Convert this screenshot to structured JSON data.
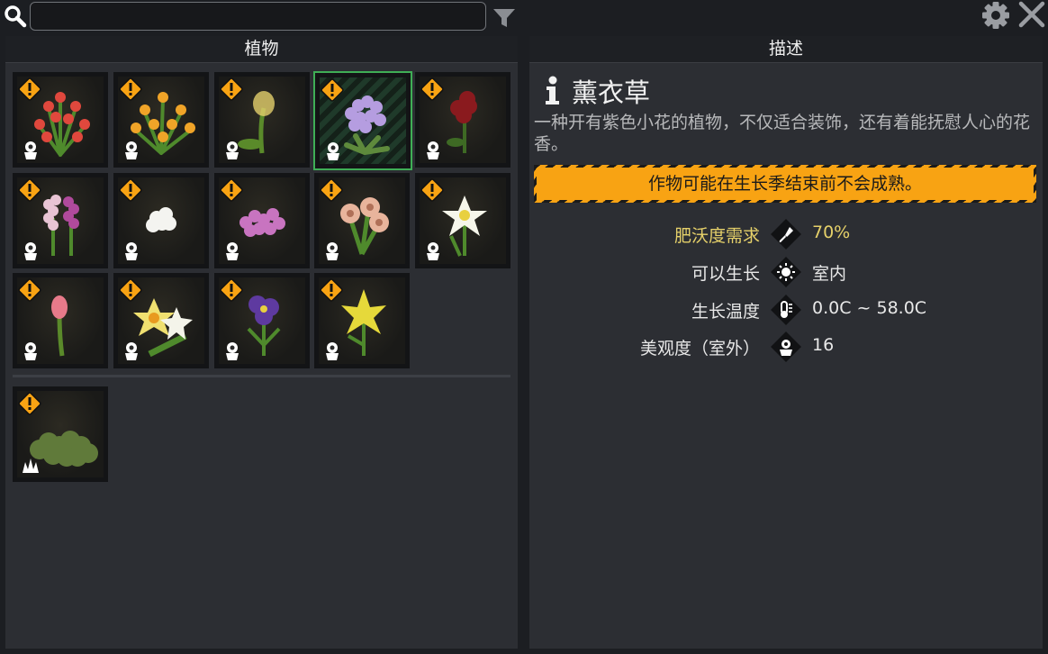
{
  "search": {
    "value": "",
    "placeholder": ""
  },
  "left_panel": {
    "title": "植物"
  },
  "right_panel": {
    "title": "描述"
  },
  "plants": [
    {
      "icon": "red-flower-plant",
      "warning": true,
      "type": "flower-pot"
    },
    {
      "icon": "orange-flower-plant",
      "warning": true,
      "type": "flower-pot"
    },
    {
      "icon": "yellow-tulip-plant",
      "warning": true,
      "type": "flower-pot"
    },
    {
      "icon": "lavender-plant",
      "warning": true,
      "type": "flower-pot",
      "selected": true
    },
    {
      "icon": "dark-red-rose-plant",
      "warning": true,
      "type": "flower-pot"
    },
    {
      "icon": "hyacinth-plant",
      "warning": true,
      "type": "flower-pot"
    },
    {
      "icon": "white-flower-plant",
      "warning": true,
      "type": "flower-pot"
    },
    {
      "icon": "pink-phlox-plant",
      "warning": true,
      "type": "flower-pot"
    },
    {
      "icon": "peach-rose-plant",
      "warning": true,
      "type": "flower-pot"
    },
    {
      "icon": "white-lily-plant",
      "warning": true,
      "type": "flower-pot"
    },
    {
      "icon": "pink-tulip-plant",
      "warning": true,
      "type": "flower-pot"
    },
    {
      "icon": "daffodil-plant",
      "warning": true,
      "type": "flower-pot"
    },
    {
      "icon": "purple-iris-plant",
      "warning": true,
      "type": "flower-pot"
    },
    {
      "icon": "yellow-lily-plant",
      "warning": true,
      "type": "flower-pot"
    },
    {
      "icon": "green-bush-plant",
      "warning": true,
      "type": "grass"
    }
  ],
  "detail": {
    "name": "薰衣草",
    "description": "一种开有紫色小花的植物，不仅适合装饰，还有着能抚慰人心的花香。",
    "warning": "作物可能在生长季结束前不会成熟。",
    "stats": [
      {
        "label": "肥沃度需求",
        "icon": "shovel-icon",
        "value": "70%",
        "highlight": true
      },
      {
        "label": "可以生长",
        "icon": "sun-icon",
        "value": "室内",
        "highlight": false
      },
      {
        "label": "生长温度",
        "icon": "thermometer-icon",
        "value": "0.0C ~ 58.0C",
        "highlight": false
      },
      {
        "label": "美观度（室外）",
        "icon": "flower-icon",
        "value": "16",
        "highlight": false
      }
    ]
  },
  "colors": {
    "warning": "#f8a313",
    "selected_border": "#3fae56",
    "highlight_text": "#e6d16a"
  }
}
